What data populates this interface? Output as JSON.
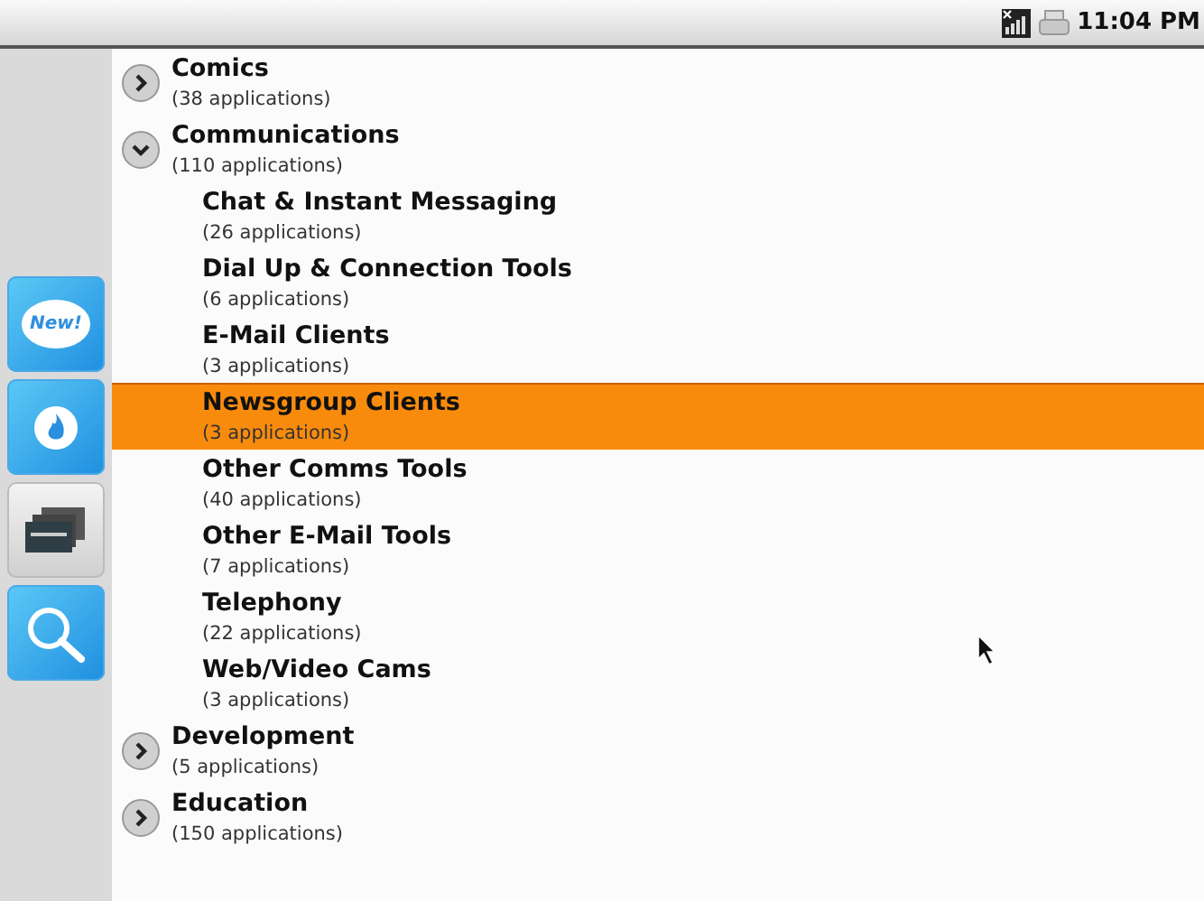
{
  "status_bar": {
    "time": "11:04 PM"
  },
  "side_buttons": [
    {
      "kind": "new",
      "label": "New!"
    },
    {
      "kind": "hot"
    },
    {
      "kind": "folders"
    },
    {
      "kind": "search"
    }
  ],
  "categories": [
    {
      "title": "Comics",
      "count": "(38 applications)",
      "expanded": false,
      "selected": false
    },
    {
      "title": "Communications",
      "count": "(110 applications)",
      "expanded": true,
      "selected": false,
      "children": [
        {
          "title": "Chat & Instant Messaging",
          "count": "(26 applications)",
          "selected": false
        },
        {
          "title": "Dial Up & Connection Tools",
          "count": "(6 applications)",
          "selected": false
        },
        {
          "title": "E-Mail Clients",
          "count": "(3 applications)",
          "selected": false
        },
        {
          "title": "Newsgroup Clients",
          "count": "(3 applications)",
          "selected": true
        },
        {
          "title": "Other Comms Tools",
          "count": "(40 applications)",
          "selected": false
        },
        {
          "title": "Other E-Mail Tools",
          "count": "(7 applications)",
          "selected": false
        },
        {
          "title": "Telephony",
          "count": "(22 applications)",
          "selected": false
        },
        {
          "title": "Web/Video Cams",
          "count": "(3 applications)",
          "selected": false
        }
      ]
    },
    {
      "title": "Development",
      "count": "(5 applications)",
      "expanded": false,
      "selected": false
    },
    {
      "title": "Education",
      "count": "(150 applications)",
      "expanded": false,
      "selected": false
    }
  ]
}
